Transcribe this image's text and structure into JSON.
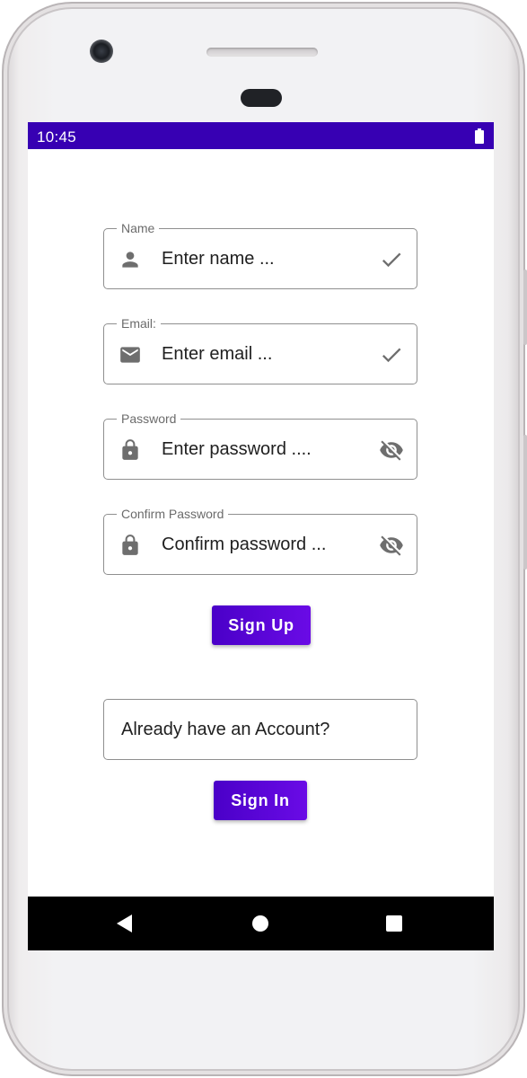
{
  "status_bar": {
    "time": "10:45"
  },
  "form": {
    "name": {
      "label": "Name",
      "placeholder": "Enter name ...",
      "icon": "person-icon",
      "trailing_icon": "check-icon"
    },
    "email": {
      "label": "Email:",
      "placeholder": "Enter email ...",
      "icon": "mail-icon",
      "trailing_icon": "check-icon"
    },
    "password": {
      "label": "Password",
      "placeholder": "Enter password ....",
      "icon": "lock-icon",
      "trailing_icon": "eye-off-icon"
    },
    "confirm": {
      "label": "Confirm Password",
      "placeholder": "Confirm password ...",
      "icon": "lock-icon",
      "trailing_icon": "eye-off-icon"
    }
  },
  "signup_button": {
    "label": "Sign Up"
  },
  "account_prompt": {
    "text": "Already have an Account?"
  },
  "signin_button": {
    "label": "Sign In"
  },
  "colors": {
    "status_bar": "#3700b3",
    "button_start": "#4a00c8",
    "button_end": "#6a0be6",
    "icon": "#6e6e6e",
    "field_border": "#8f8f8f"
  }
}
